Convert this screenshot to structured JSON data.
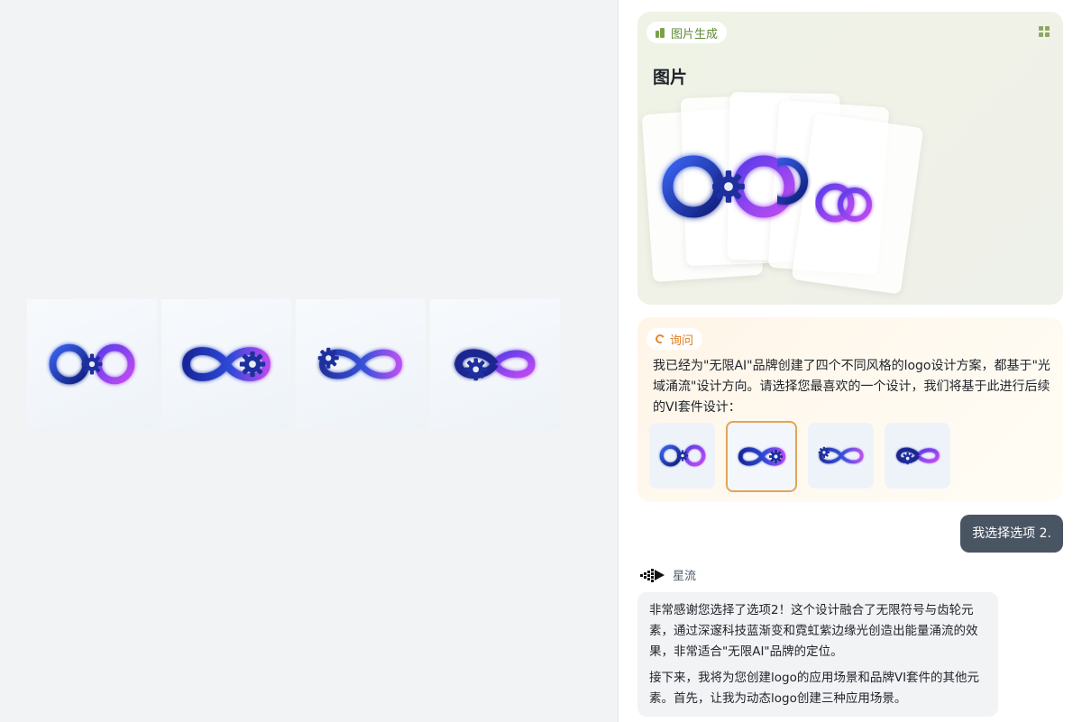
{
  "canvas": {
    "strip_images": [
      {
        "icon": "infinity-gear-logo-variant-1"
      },
      {
        "icon": "infinity-gear-logo-variant-2"
      },
      {
        "icon": "infinity-gear-logo-variant-3"
      },
      {
        "icon": "infinity-gear-logo-variant-4"
      }
    ]
  },
  "generation_card": {
    "badge_label": "图片生成",
    "badge_icon": "image-generation-icon",
    "menu_icon": "grid-icon",
    "title": "图片",
    "preview_icon": "infinity-gear-logo-stack"
  },
  "ask_card": {
    "badge_label": "询问",
    "badge_icon": "swirl-icon",
    "message": "我已经为\"无限AI\"品牌创建了四个不同风格的logo设计方案，都基于\"光域涌流\"设计方向。请选择您最喜欢的一个设计，我们将基于此进行后续的VI套件设计：",
    "options": [
      {
        "icon": "logo-option-1",
        "selected": false
      },
      {
        "icon": "logo-option-2",
        "selected": true
      },
      {
        "icon": "logo-option-3",
        "selected": false
      },
      {
        "icon": "logo-option-4",
        "selected": false
      }
    ]
  },
  "user_message": "我选择选项 2.",
  "agent": {
    "name": "星流",
    "avatar_icon": "xingliu-logo-icon",
    "paragraphs": [
      "非常感谢您选择了选项2！这个设计融合了无限符号与齿轮元素，通过深邃科技蓝渐变和霓虹紫边缘光创造出能量涌流的效果，非常适合\"无限AI\"品牌的定位。",
      "接下来，我将为您创建logo的应用场景和品牌VI套件的其他元素。首先，让我为动态logo创建三种应用场景。"
    ]
  },
  "colors": {
    "logo_blue_dark": "#16268f",
    "logo_blue": "#2a4fd6",
    "logo_purple": "#8a3cf0",
    "logo_magenta": "#d24bf5",
    "gen_accent": "#5f8a34",
    "ask_accent": "#e07a22",
    "selected_border": "#e3a458",
    "user_bubble": "#4a5563"
  }
}
